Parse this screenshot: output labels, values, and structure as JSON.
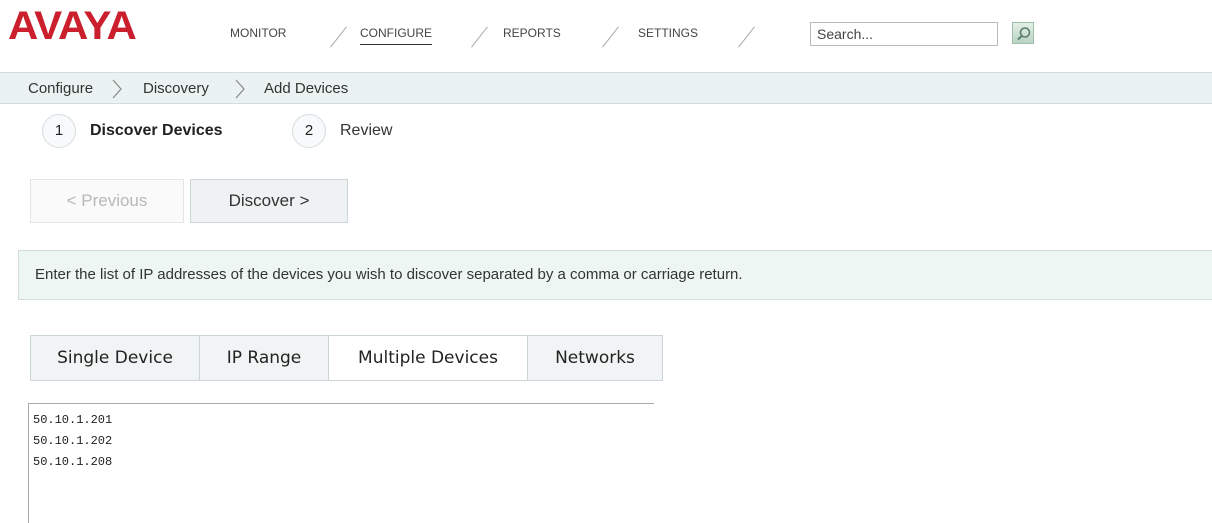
{
  "brand": {
    "logo_text": "AVAYA",
    "color": "#cc1f2e"
  },
  "nav": {
    "items": [
      {
        "label": "MONITOR",
        "active": false
      },
      {
        "label": "CONFIGURE",
        "active": true
      },
      {
        "label": "REPORTS",
        "active": false
      },
      {
        "label": "SETTINGS",
        "active": false
      }
    ]
  },
  "search": {
    "placeholder": "Search...",
    "icon": "search-icon"
  },
  "breadcrumb": {
    "items": [
      "Configure",
      "Discovery",
      "Add Devices"
    ],
    "separator": "chevron-right-icon"
  },
  "wizard": {
    "steps": [
      {
        "number": "1",
        "label": "Discover Devices",
        "active": true
      },
      {
        "number": "2",
        "label": "Review",
        "active": false
      }
    ],
    "previous_label": "< Previous",
    "discover_label": "Discover >"
  },
  "info_message": "Enter the list of IP addresses of the devices you wish to discover separated by a comma or carriage return.",
  "tabs": [
    {
      "label": "Single Device",
      "active": false
    },
    {
      "label": "IP Range",
      "active": false
    },
    {
      "label": "Multiple Devices",
      "active": true
    },
    {
      "label": "Networks",
      "active": false
    }
  ],
  "ip_list": {
    "value": "50.10.1.201\n50.10.1.202\n50.10.1.208"
  },
  "colors": {
    "accent_bg": "#edf6f3",
    "border": "#ccd6d8"
  }
}
